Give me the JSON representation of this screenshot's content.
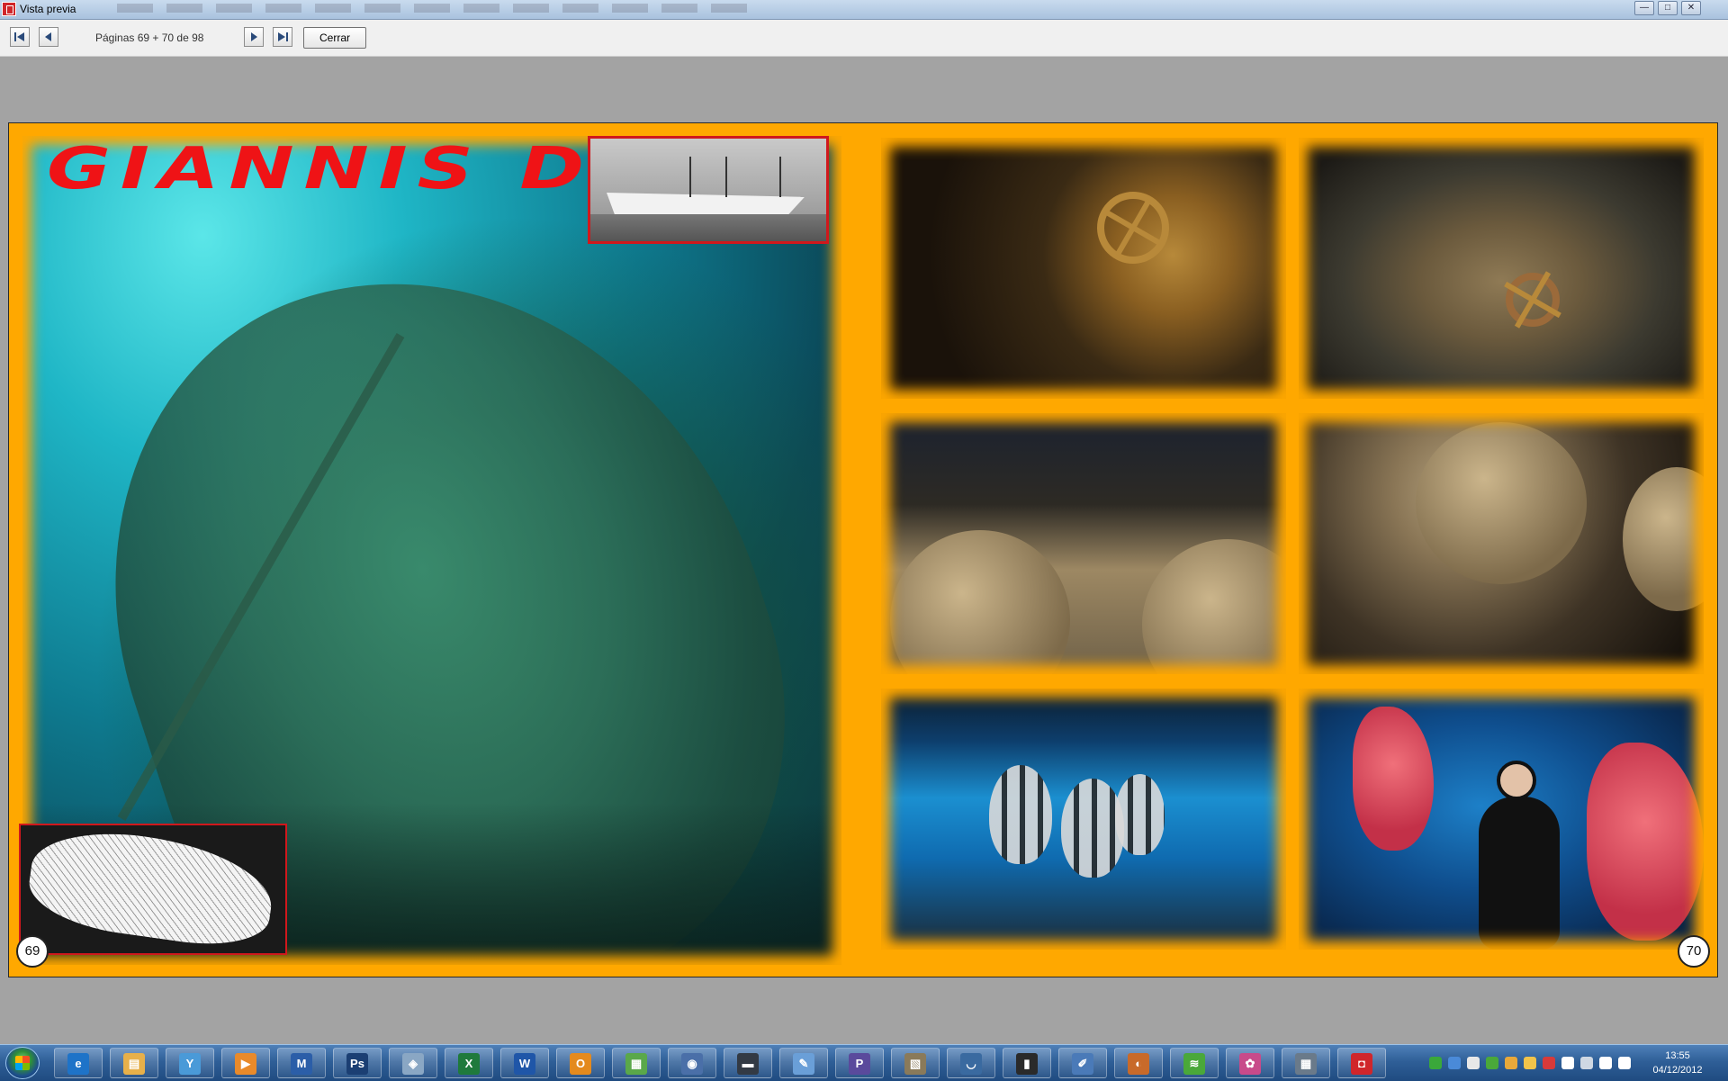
{
  "window": {
    "title": "Vista previa",
    "controls": [
      "—",
      "□",
      "✕"
    ]
  },
  "toolbar": {
    "page_info": "Páginas 69 + 70 de 98",
    "close_label": "Cerrar"
  },
  "book": {
    "title": "GIANNIS D",
    "left_page_number": "69",
    "right_page_number": "70"
  },
  "taskbar": {
    "apps": [
      {
        "icon": "internet-explorer-icon",
        "glyph": "e",
        "color": "#1e73c8"
      },
      {
        "icon": "file-explorer-icon",
        "glyph": "▤",
        "color": "#e7b04a"
      },
      {
        "icon": "tool-app-icon",
        "glyph": "Y",
        "color": "#4a9ad8"
      },
      {
        "icon": "media-player-icon",
        "glyph": "▶",
        "color": "#e98a2a"
      },
      {
        "icon": "graph-app-icon",
        "glyph": "M",
        "color": "#2b5ea8"
      },
      {
        "icon": "photoshop-icon",
        "glyph": "Ps",
        "color": "#1b3f73"
      },
      {
        "icon": "notes-app-icon",
        "glyph": "◈",
        "color": "#8aa7c4"
      },
      {
        "icon": "excel-icon",
        "glyph": "X",
        "color": "#1f7a3c"
      },
      {
        "icon": "word-icon",
        "glyph": "W",
        "color": "#1f56a8"
      },
      {
        "icon": "outlook-icon",
        "glyph": "O",
        "color": "#e48a1e"
      },
      {
        "icon": "image-viewer-icon",
        "glyph": "▦",
        "color": "#5aa84a"
      },
      {
        "icon": "globe-app-icon",
        "glyph": "◉",
        "color": "#4a6fa8"
      },
      {
        "icon": "film-app-icon",
        "glyph": "▬",
        "color": "#333a44"
      },
      {
        "icon": "paint-app-icon",
        "glyph": "✎",
        "color": "#6a9fd8"
      },
      {
        "icon": "p-app-icon",
        "glyph": "P",
        "color": "#5a4a9c"
      },
      {
        "icon": "scanner-app-icon",
        "glyph": "▧",
        "color": "#8a7a5a"
      },
      {
        "icon": "headset-app-icon",
        "glyph": "◡",
        "color": "#3a6aa0"
      },
      {
        "icon": "usb-app-icon",
        "glyph": "▮",
        "color": "#2a2a2a"
      },
      {
        "icon": "pen-app-icon",
        "glyph": "✐",
        "color": "#4a7ab8"
      },
      {
        "icon": "baseball-glove-icon",
        "glyph": "◐",
        "color": "#c86a2a"
      },
      {
        "icon": "spotify-icon",
        "glyph": "≋",
        "color": "#4aa83a"
      },
      {
        "icon": "picasa-icon",
        "glyph": "✿",
        "color": "#c84a8a"
      },
      {
        "icon": "calculator-icon",
        "glyph": "▦",
        "color": "#6a7a8a"
      },
      {
        "icon": "album-app-icon",
        "glyph": "◘",
        "color": "#d0262b"
      }
    ],
    "tray": [
      {
        "icon": "network-tray-icon",
        "color": "#3aa83a"
      },
      {
        "icon": "dropbox-tray-icon",
        "color": "#4a8ad8"
      },
      {
        "icon": "mail-tray-icon",
        "color": "#e8e8e8"
      },
      {
        "icon": "spotify-tray-icon",
        "color": "#4aa83a"
      },
      {
        "icon": "app-tray-icon",
        "color": "#e8a83a"
      },
      {
        "icon": "sync-tray-icon",
        "color": "#f2c44a"
      },
      {
        "icon": "antivirus-tray-icon",
        "color": "#d83a3a"
      },
      {
        "icon": "flag-tray-icon",
        "color": "#ffffff"
      },
      {
        "icon": "monitor-tray-icon",
        "color": "#cfd8e3"
      },
      {
        "icon": "signal-tray-icon",
        "color": "#ffffff"
      },
      {
        "icon": "volume-tray-icon",
        "color": "#ffffff"
      }
    ],
    "time": "13:55",
    "date": "04/12/2012"
  },
  "colors": {
    "spread_background": "#ffa800",
    "title_red": "#ef1316",
    "inset_border": "#d0181c"
  }
}
